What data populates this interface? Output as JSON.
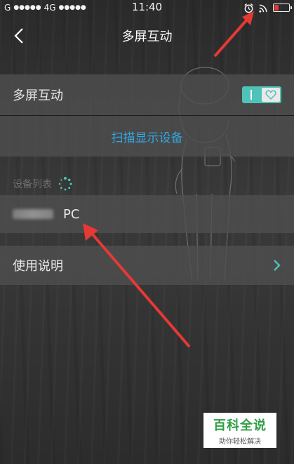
{
  "status_bar": {
    "carrier": "G",
    "signal1": "●●●●●",
    "network": "4G",
    "signal2": "●●●●●",
    "time": "11:40"
  },
  "nav": {
    "title": "多屏互动"
  },
  "multi_screen_row": {
    "label": "多屏互动",
    "toggle_on": true
  },
  "scan_row": {
    "label": "扫描显示设备"
  },
  "device_list": {
    "section_label": "设备列表",
    "devices": [
      {
        "name_suffix": "PC"
      }
    ]
  },
  "usage_row": {
    "label": "使用说明"
  },
  "watermark": {
    "main": "百科全说",
    "sub": "助你轻松解决"
  },
  "colors": {
    "accent_teal": "#4fc3b9",
    "link_blue": "#31a9e6",
    "arrow_red": "#e53935"
  }
}
